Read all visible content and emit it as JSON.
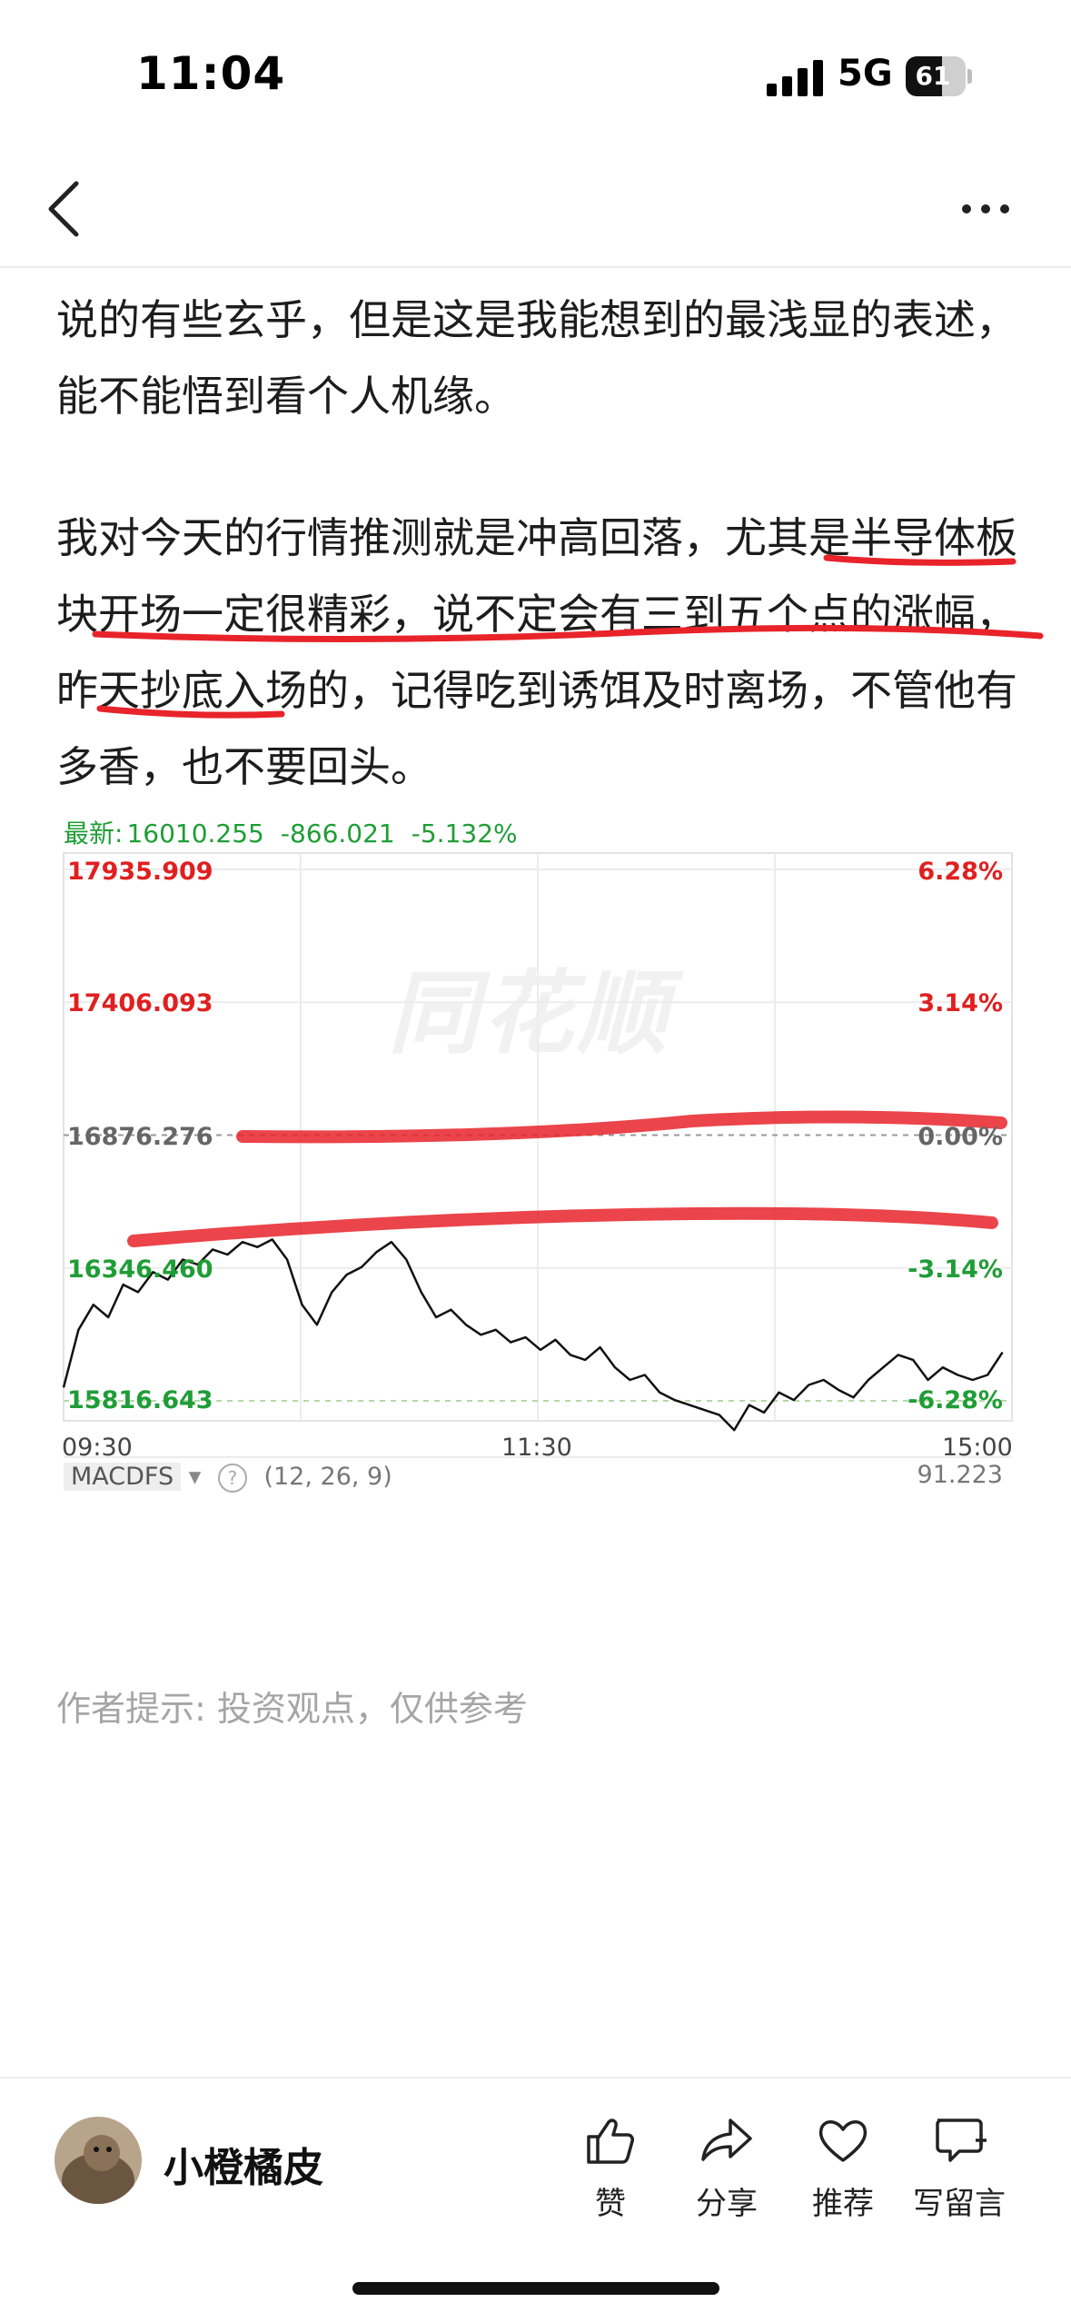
{
  "status_bar": {
    "time": "11:04",
    "network": "5G",
    "battery": "61",
    "battery_level": 0.61
  },
  "nav": {
    "back_icon": "chevron-left-icon",
    "more_icon": "ellipsis-icon"
  },
  "article": {
    "paragraph1": "说的有些玄乎，但是这是我能想到的最浅显的表述，能不能悟到看个人机缘。",
    "paragraph2": "我对今天的行情推测就是冲高回落，尤其是半导体板块开场一定很精彩，说不定会有三到五个点的涨幅，昨天抄底入场的，记得吃到诱饵及时离场，不管他有多香，也不要回头。"
  },
  "chart": {
    "header_label": "最新:",
    "latest": "16010.255",
    "change": "-866.021",
    "change_pct": "-5.132%",
    "watermark": "同花顺",
    "y_left": [
      "17935.909",
      "17406.093",
      "16876.276",
      "16346.460",
      "15816.643"
    ],
    "y_right": [
      "6.28%",
      "3.14%",
      "0.00%",
      "-3.14%",
      "-6.28%"
    ],
    "x_labels": [
      "09:30",
      "11:30",
      "15:00"
    ],
    "indicator": "MACDFS",
    "indicator_params": "(12, 26, 9)",
    "indicator_value": "91.223",
    "colors": {
      "up": "#e02020",
      "down": "#1f9d36",
      "line": "#111111",
      "annotation": "#e8232a"
    }
  },
  "chart_data": {
    "type": "line",
    "x_start": "09:30",
    "x_mid": "11:30",
    "x_end": "15:00",
    "ylim": [
      15816.643,
      17935.909
    ],
    "prev_close": 16876.276,
    "y": [
      15870,
      16100,
      16200,
      16150,
      16280,
      16250,
      16330,
      16300,
      16380,
      16360,
      16420,
      16400,
      16450,
      16430,
      16460,
      16380,
      16200,
      16120,
      16250,
      16320,
      16350,
      16410,
      16450,
      16380,
      16250,
      16150,
      16180,
      16120,
      16080,
      16100,
      16050,
      16070,
      16020,
      16060,
      16000,
      15980,
      16030,
      15950,
      15900,
      15920,
      15850,
      15820,
      15800,
      15780,
      15760,
      15700,
      15800,
      15770,
      15850,
      15820,
      15880,
      15900,
      15860,
      15830,
      15900,
      15950,
      16000,
      15980,
      15900,
      15950,
      15920,
      15900,
      15920,
      16010
    ]
  },
  "footer": {
    "author_note": "作者提示: 投资观点，仅供参考"
  },
  "bottom": {
    "author": "小橙橘皮",
    "actions": [
      {
        "label": "赞",
        "icon": "thumbs-up-icon"
      },
      {
        "label": "分享",
        "icon": "share-icon"
      },
      {
        "label": "推荐",
        "icon": "heart-icon"
      },
      {
        "label": "写留言",
        "icon": "comment-icon"
      }
    ]
  }
}
